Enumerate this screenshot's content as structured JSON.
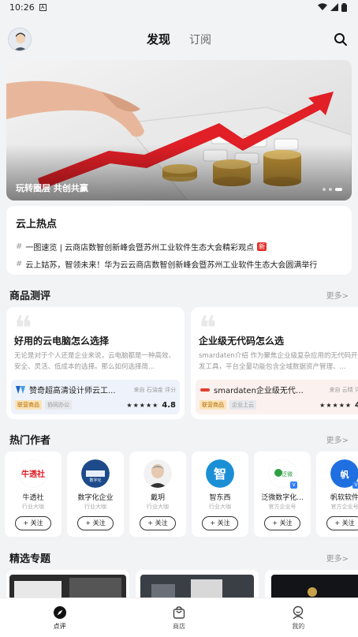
{
  "status_bar": {
    "time": "10:26",
    "badge": "A"
  },
  "header": {
    "tabs": [
      {
        "label": "发现",
        "active": true
      },
      {
        "label": "订阅",
        "active": false
      }
    ]
  },
  "banner": {
    "caption": "玩转圈层 共创共赢",
    "dots": 3,
    "active_dot": 3
  },
  "hot": {
    "title": "云上热点",
    "items": [
      {
        "hash": "#",
        "text": "一图速览 | 云商店数智创新峰会暨苏州工业软件生态大会精彩观点",
        "badge": "新"
      },
      {
        "hash": "#",
        "text": "云上姑苏，智领未来！华为云云商店数智创新峰会暨苏州工业软件生态大会圆满举行",
        "badge": ""
      }
    ]
  },
  "reviews": {
    "title": "商品测评",
    "more": "更多>",
    "cards": [
      {
        "title": "好用的云电脑怎么选择",
        "desc": "无论是对于个人还是企业来说，云电脑都是一种高效、安全、灵活、低成本的选择。那么如何选择简...",
        "product": "赞奇超高清设计师云工...",
        "source": "来自 石油金 评分",
        "tag1": "联营商品",
        "tag2": "协同办公",
        "stars": "★★★★★",
        "rating": "4.8"
      },
      {
        "title": "企业级无代码怎么选",
        "desc": "smardaten介绍 作为聚焦企业级复杂应用的无代码开发工具，平台全量功能包含全域数据资产管理、...",
        "product": "smardaten企业级无代码...",
        "source": "来自 云晴 评",
        "tag1": "联营商品",
        "tag2": "企业上云",
        "stars": "★★★★★",
        "rating": "4"
      }
    ]
  },
  "authors": {
    "title": "热门作者",
    "more": "更多>",
    "follow_label": "+ 关注",
    "items": [
      {
        "name": "牛透社",
        "role": "行业大咖",
        "verified": false,
        "color": "#e21b23"
      },
      {
        "name": "数字化企业",
        "role": "行业大咖",
        "verified": false,
        "color": "#1d4a8a"
      },
      {
        "name": "戴玥",
        "role": "行业大咖",
        "verified": false,
        "color": "#b9a795"
      },
      {
        "name": "智东西",
        "role": "行业大咖",
        "verified": false,
        "color": "#1b8fd6"
      },
      {
        "name": "泛微数字化...",
        "role": "官方企业号",
        "verified": true,
        "color": "#2ea043"
      },
      {
        "name": "帆软软件",
        "role": "官方企业号",
        "verified": true,
        "color": "#1f6fe0"
      }
    ]
  },
  "topics": {
    "title": "精选专题",
    "more": "更多>"
  },
  "bottom_nav": [
    {
      "label": "点评",
      "icon": "compass-icon",
      "active": true
    },
    {
      "label": "商店",
      "icon": "bag-icon",
      "active": false
    },
    {
      "label": "我的",
      "icon": "user-icon",
      "active": false
    }
  ]
}
